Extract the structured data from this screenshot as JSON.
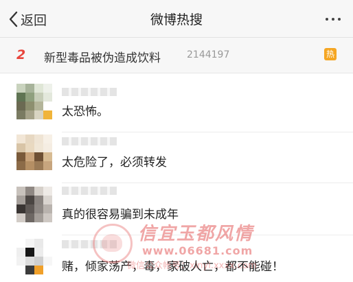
{
  "nav": {
    "back_label": "返回",
    "title": "微博热搜"
  },
  "topic": {
    "rank": "2",
    "text": "新型毒品被伪造成饮料",
    "count": "2144197",
    "badge": "热",
    "rank_color": "#e8453c",
    "badge_color": "#f5a623"
  },
  "comments": [
    {
      "text": "太恐怖。"
    },
    {
      "text": "太危险了，必须转发"
    },
    {
      "text": "真的很容易骗到未成年"
    },
    {
      "text": "赌，倾家荡产，毒，家破人亡，都不能碰！"
    }
  ],
  "watermark": {
    "title": "信宜玉都风情",
    "url": "www.06681.com",
    "bottom": "微信公众帐号：xinyi.xxxx.com"
  }
}
